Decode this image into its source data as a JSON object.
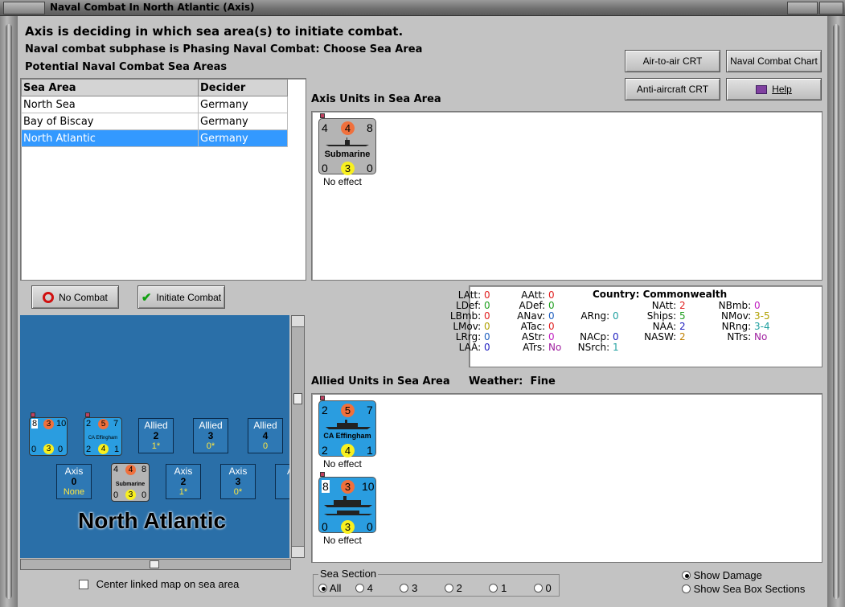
{
  "window": {
    "title": "Naval Combat In North Atlantic (Axis)"
  },
  "header": {
    "line1": "Axis is deciding in which sea area(s) to initiate combat.",
    "line2": "Naval combat subphase is Phasing Naval Combat: Choose Sea Area",
    "line3": "Potential Naval Combat Sea Areas"
  },
  "toolbar": {
    "air_crt": "Air-to-air CRT",
    "naval_chart": "Naval Combat Chart",
    "aa_crt": "Anti-aircraft CRT",
    "help": "Help"
  },
  "sea_table": {
    "col_area": "Sea Area",
    "col_decider": "Decider",
    "rows": [
      {
        "area": "North Sea",
        "decider": "Germany"
      },
      {
        "area": "Bay of Biscay",
        "decider": "Germany"
      },
      {
        "area": "North Atlantic",
        "decider": "Germany"
      }
    ]
  },
  "actions": {
    "no_combat": "No Combat",
    "initiate": "Initiate Combat"
  },
  "axis_units": {
    "label": "Axis Units in Sea Area",
    "unit": {
      "tl": "4",
      "tm": "4",
      "tr": "8",
      "name": "Submarine",
      "bl": "0",
      "bm": "3",
      "br": "0",
      "effect": "No effect"
    }
  },
  "stats": {
    "country_label": "Country:",
    "country": "Commonwealth",
    "items": [
      {
        "k": "LAtt:",
        "v": "0",
        "c": "#e02020"
      },
      {
        "k": "LDef:",
        "v": "0",
        "c": "#20a020"
      },
      {
        "k": "LBmb:",
        "v": "0",
        "c": "#e02020"
      },
      {
        "k": "LMov:",
        "v": "0",
        "c": "#b0a000"
      },
      {
        "k": "LRrg:",
        "v": "0",
        "c": "#2060c0"
      },
      {
        "k": "LAA:",
        "v": "0",
        "c": "#2020c0"
      },
      {
        "k": "AAtt:",
        "v": "0",
        "c": "#e02020"
      },
      {
        "k": "ADef:",
        "v": "0",
        "c": "#20a020"
      },
      {
        "k": "ANav:",
        "v": "0",
        "c": "#2060c0"
      },
      {
        "k": "ATac:",
        "v": "0",
        "c": "#e02020"
      },
      {
        "k": "AStr:",
        "v": "0",
        "c": "#c020c0"
      },
      {
        "k": "ATrs:",
        "v": "No",
        "c": "#a020a0"
      },
      {
        "k": "ARng:",
        "v": "0",
        "c": "#20a0a0"
      },
      {
        "k": "NACp:",
        "v": "0",
        "c": "#2020c0"
      },
      {
        "k": "NSrch:",
        "v": "1",
        "c": "#20a0a0"
      },
      {
        "k": "NAtt:",
        "v": "2",
        "c": "#e02020"
      },
      {
        "k": "Ships:",
        "v": "5",
        "c": "#20a020"
      },
      {
        "k": "NAA:",
        "v": "2",
        "c": "#2020c0"
      },
      {
        "k": "NASW:",
        "v": "2",
        "c": "#c08000"
      },
      {
        "k": "NBmb:",
        "v": "0",
        "c": "#c020c0"
      },
      {
        "k": "NMov:",
        "v": "3-5",
        "c": "#b0a000"
      },
      {
        "k": "NRng:",
        "v": "3-4",
        "c": "#20a0a0"
      },
      {
        "k": "NTrs:",
        "v": "No",
        "c": "#a020a0"
      }
    ]
  },
  "allied_units": {
    "label": "Allied Units in Sea Area",
    "weather_label": "Weather:",
    "weather": "Fine",
    "units": [
      {
        "tl": "2",
        "tm": "5",
        "tr": "7",
        "name": "CA Effingham",
        "bl": "2",
        "bm": "4",
        "br": "1",
        "effect": "No effect"
      },
      {
        "tl": "8",
        "tm": "3",
        "tr": "10",
        "name": "",
        "bl": "0",
        "bm": "3",
        "br": "0",
        "effect": "No effect"
      }
    ]
  },
  "map": {
    "title": "North Atlantic",
    "allied_boxes": [
      {
        "side": "Allied",
        "num": "2",
        "sub": "1*"
      },
      {
        "side": "Allied",
        "num": "3",
        "sub": "0*"
      },
      {
        "side": "Allied",
        "num": "4",
        "sub": "0"
      }
    ],
    "axis_boxes": [
      {
        "side": "Axis",
        "num": "0",
        "sub": "None"
      },
      {
        "side": "Axis",
        "num": "2",
        "sub": "1*"
      },
      {
        "side": "Axis",
        "num": "3",
        "sub": "0*"
      },
      {
        "side": "Ax"
      }
    ],
    "counter_a": {
      "tl": "8",
      "tm": "3",
      "tr": "10",
      "bl": "0",
      "bm": "3",
      "br": "0"
    },
    "counter_b": {
      "tl": "2",
      "tm": "5",
      "tr": "7",
      "name": "CA Effingham",
      "bl": "2",
      "bm": "4",
      "br": "1"
    },
    "counter_c": {
      "tl": "4",
      "tm": "4",
      "tr": "8",
      "name": "Submarine",
      "bl": "0",
      "bm": "3",
      "br": "0"
    },
    "center_linked": "Center linked map on sea area"
  },
  "sea_section": {
    "label": "Sea Section",
    "options": [
      "All",
      "4",
      "3",
      "2",
      "1",
      "0"
    ],
    "selected": "All"
  },
  "display": {
    "show_damage": "Show Damage",
    "show_sections": "Show Sea Box Sections"
  }
}
